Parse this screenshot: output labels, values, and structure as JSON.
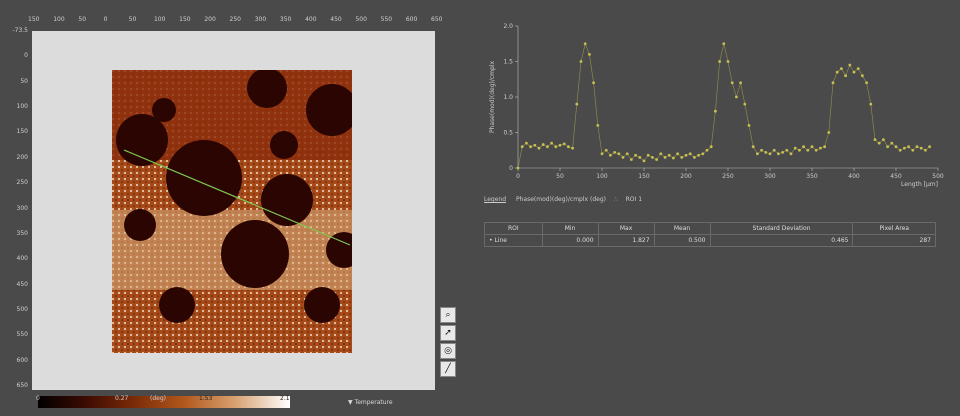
{
  "image_view": {
    "x_ticks": [
      "150",
      "100",
      "50",
      "0",
      "50",
      "100",
      "150",
      "200",
      "250",
      "300",
      "350",
      "400",
      "450",
      "500",
      "550",
      "600",
      "650"
    ],
    "y_ticks": [
      "-73.5",
      "0",
      "50",
      "100",
      "150",
      "200",
      "250",
      "300",
      "350",
      "400",
      "450",
      "500",
      "550",
      "600",
      "650"
    ],
    "colorbar": {
      "labels": [
        "0",
        "0.27",
        "(deg)",
        "1.53",
        "2.1"
      ],
      "scale_selector": "Temperature"
    },
    "tools": [
      "zoom-icon",
      "pointer-icon",
      "pan-icon",
      "line-icon"
    ]
  },
  "profile_plot": {
    "ylabel": "Phase(mod)(deg)/cmplx",
    "xlabel": "Length [µm]",
    "x_ticks": [
      "0",
      "50",
      "100",
      "150",
      "200",
      "250",
      "300",
      "350",
      "400",
      "450",
      "500"
    ],
    "y_ticks": [
      "0",
      "0.5",
      "1.0",
      "1.5",
      "2.0"
    ],
    "legend_label": "Legend",
    "legend_entries": [
      "Phase(mod)(deg)/cmplx (deg)",
      "ROI 1"
    ],
    "colors": {
      "series": "#c8c050",
      "line": "#ffffff"
    }
  },
  "stats_table": {
    "headers": [
      "ROI",
      "Min",
      "Max",
      "Mean",
      "Standard Deviation",
      "Pixel Area"
    ],
    "rows": [
      [
        "Line",
        "0.000",
        "1.827",
        "0.500",
        "0.465",
        "287"
      ]
    ]
  },
  "chart_data": {
    "type": "scatter",
    "x": [
      0,
      5,
      10,
      15,
      20,
      25,
      30,
      35,
      40,
      45,
      50,
      55,
      60,
      65,
      70,
      75,
      80,
      85,
      90,
      95,
      100,
      105,
      110,
      115,
      120,
      125,
      130,
      135,
      140,
      145,
      150,
      155,
      160,
      165,
      170,
      175,
      180,
      185,
      190,
      195,
      200,
      205,
      210,
      215,
      220,
      225,
      230,
      235,
      240,
      245,
      250,
      255,
      260,
      265,
      270,
      275,
      280,
      285,
      290,
      295,
      300,
      305,
      310,
      315,
      320,
      325,
      330,
      335,
      340,
      345,
      350,
      355,
      360,
      365,
      370,
      375,
      380,
      385,
      390,
      395,
      400,
      405,
      410,
      415,
      420,
      425,
      430,
      435,
      440,
      445,
      450,
      455,
      460,
      465,
      470,
      475,
      480,
      485,
      490
    ],
    "y": [
      0.0,
      0.3,
      0.35,
      0.3,
      0.32,
      0.28,
      0.33,
      0.3,
      0.35,
      0.3,
      0.32,
      0.34,
      0.3,
      0.28,
      0.9,
      1.5,
      1.75,
      1.6,
      1.2,
      0.6,
      0.2,
      0.25,
      0.18,
      0.22,
      0.2,
      0.15,
      0.2,
      0.12,
      0.18,
      0.15,
      0.1,
      0.18,
      0.15,
      0.12,
      0.2,
      0.15,
      0.18,
      0.14,
      0.2,
      0.15,
      0.18,
      0.2,
      0.15,
      0.18,
      0.2,
      0.25,
      0.3,
      0.8,
      1.5,
      1.75,
      1.5,
      1.2,
      1.0,
      1.2,
      0.9,
      0.6,
      0.3,
      0.2,
      0.25,
      0.22,
      0.2,
      0.25,
      0.2,
      0.22,
      0.25,
      0.2,
      0.28,
      0.25,
      0.3,
      0.25,
      0.3,
      0.25,
      0.28,
      0.3,
      0.5,
      1.2,
      1.35,
      1.4,
      1.3,
      1.45,
      1.35,
      1.4,
      1.3,
      1.2,
      0.9,
      0.4,
      0.35,
      0.4,
      0.3,
      0.35,
      0.3,
      0.25,
      0.28,
      0.3,
      0.25,
      0.3,
      0.28,
      0.25,
      0.3
    ],
    "xlabel": "Length [µm]",
    "ylabel": "Phase(mod)(deg)/cmplx",
    "xlim": [
      0,
      500
    ],
    "ylim": [
      0,
      2.0
    ],
    "grid": false,
    "legend": "bottom-left"
  }
}
